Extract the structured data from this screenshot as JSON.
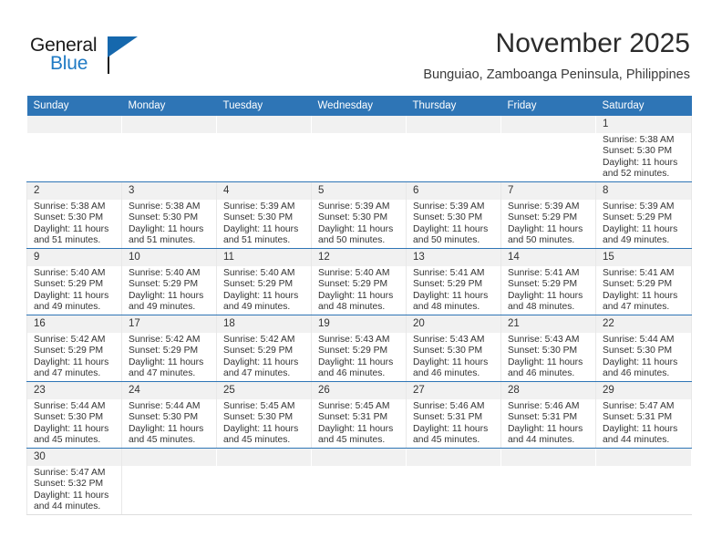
{
  "brand": {
    "name_part1": "General",
    "name_part2": "Blue",
    "flag_icon": "blue-flag-triangle",
    "colors": {
      "general_text": "#1a1a1a",
      "blue_text": "#1f7ac4",
      "flag": "#1668ad"
    }
  },
  "header": {
    "title": "November 2025",
    "subtitle": "Bunguiao, Zamboanga Peninsula, Philippines"
  },
  "theme": {
    "header_row_bg": "#2e75b6",
    "header_row_text": "#ffffff",
    "daynum_bg": "#f1f1f1",
    "row_divider": "#2e75b6",
    "cell_divider": "#e8e8e8",
    "body_text": "#333333"
  },
  "weekdays": [
    "Sunday",
    "Monday",
    "Tuesday",
    "Wednesday",
    "Thursday",
    "Friday",
    "Saturday"
  ],
  "weeks": [
    [
      {
        "day": "",
        "lines": []
      },
      {
        "day": "",
        "lines": []
      },
      {
        "day": "",
        "lines": []
      },
      {
        "day": "",
        "lines": []
      },
      {
        "day": "",
        "lines": []
      },
      {
        "day": "",
        "lines": []
      },
      {
        "day": "1",
        "lines": [
          "Sunrise: 5:38 AM",
          "Sunset: 5:30 PM",
          "Daylight: 11 hours",
          "and 52 minutes."
        ]
      }
    ],
    [
      {
        "day": "2",
        "lines": [
          "Sunrise: 5:38 AM",
          "Sunset: 5:30 PM",
          "Daylight: 11 hours",
          "and 51 minutes."
        ]
      },
      {
        "day": "3",
        "lines": [
          "Sunrise: 5:38 AM",
          "Sunset: 5:30 PM",
          "Daylight: 11 hours",
          "and 51 minutes."
        ]
      },
      {
        "day": "4",
        "lines": [
          "Sunrise: 5:39 AM",
          "Sunset: 5:30 PM",
          "Daylight: 11 hours",
          "and 51 minutes."
        ]
      },
      {
        "day": "5",
        "lines": [
          "Sunrise: 5:39 AM",
          "Sunset: 5:30 PM",
          "Daylight: 11 hours",
          "and 50 minutes."
        ]
      },
      {
        "day": "6",
        "lines": [
          "Sunrise: 5:39 AM",
          "Sunset: 5:30 PM",
          "Daylight: 11 hours",
          "and 50 minutes."
        ]
      },
      {
        "day": "7",
        "lines": [
          "Sunrise: 5:39 AM",
          "Sunset: 5:29 PM",
          "Daylight: 11 hours",
          "and 50 minutes."
        ]
      },
      {
        "day": "8",
        "lines": [
          "Sunrise: 5:39 AM",
          "Sunset: 5:29 PM",
          "Daylight: 11 hours",
          "and 49 minutes."
        ]
      }
    ],
    [
      {
        "day": "9",
        "lines": [
          "Sunrise: 5:40 AM",
          "Sunset: 5:29 PM",
          "Daylight: 11 hours",
          "and 49 minutes."
        ]
      },
      {
        "day": "10",
        "lines": [
          "Sunrise: 5:40 AM",
          "Sunset: 5:29 PM",
          "Daylight: 11 hours",
          "and 49 minutes."
        ]
      },
      {
        "day": "11",
        "lines": [
          "Sunrise: 5:40 AM",
          "Sunset: 5:29 PM",
          "Daylight: 11 hours",
          "and 49 minutes."
        ]
      },
      {
        "day": "12",
        "lines": [
          "Sunrise: 5:40 AM",
          "Sunset: 5:29 PM",
          "Daylight: 11 hours",
          "and 48 minutes."
        ]
      },
      {
        "day": "13",
        "lines": [
          "Sunrise: 5:41 AM",
          "Sunset: 5:29 PM",
          "Daylight: 11 hours",
          "and 48 minutes."
        ]
      },
      {
        "day": "14",
        "lines": [
          "Sunrise: 5:41 AM",
          "Sunset: 5:29 PM",
          "Daylight: 11 hours",
          "and 48 minutes."
        ]
      },
      {
        "day": "15",
        "lines": [
          "Sunrise: 5:41 AM",
          "Sunset: 5:29 PM",
          "Daylight: 11 hours",
          "and 47 minutes."
        ]
      }
    ],
    [
      {
        "day": "16",
        "lines": [
          "Sunrise: 5:42 AM",
          "Sunset: 5:29 PM",
          "Daylight: 11 hours",
          "and 47 minutes."
        ]
      },
      {
        "day": "17",
        "lines": [
          "Sunrise: 5:42 AM",
          "Sunset: 5:29 PM",
          "Daylight: 11 hours",
          "and 47 minutes."
        ]
      },
      {
        "day": "18",
        "lines": [
          "Sunrise: 5:42 AM",
          "Sunset: 5:29 PM",
          "Daylight: 11 hours",
          "and 47 minutes."
        ]
      },
      {
        "day": "19",
        "lines": [
          "Sunrise: 5:43 AM",
          "Sunset: 5:29 PM",
          "Daylight: 11 hours",
          "and 46 minutes."
        ]
      },
      {
        "day": "20",
        "lines": [
          "Sunrise: 5:43 AM",
          "Sunset: 5:30 PM",
          "Daylight: 11 hours",
          "and 46 minutes."
        ]
      },
      {
        "day": "21",
        "lines": [
          "Sunrise: 5:43 AM",
          "Sunset: 5:30 PM",
          "Daylight: 11 hours",
          "and 46 minutes."
        ]
      },
      {
        "day": "22",
        "lines": [
          "Sunrise: 5:44 AM",
          "Sunset: 5:30 PM",
          "Daylight: 11 hours",
          "and 46 minutes."
        ]
      }
    ],
    [
      {
        "day": "23",
        "lines": [
          "Sunrise: 5:44 AM",
          "Sunset: 5:30 PM",
          "Daylight: 11 hours",
          "and 45 minutes."
        ]
      },
      {
        "day": "24",
        "lines": [
          "Sunrise: 5:44 AM",
          "Sunset: 5:30 PM",
          "Daylight: 11 hours",
          "and 45 minutes."
        ]
      },
      {
        "day": "25",
        "lines": [
          "Sunrise: 5:45 AM",
          "Sunset: 5:30 PM",
          "Daylight: 11 hours",
          "and 45 minutes."
        ]
      },
      {
        "day": "26",
        "lines": [
          "Sunrise: 5:45 AM",
          "Sunset: 5:31 PM",
          "Daylight: 11 hours",
          "and 45 minutes."
        ]
      },
      {
        "day": "27",
        "lines": [
          "Sunrise: 5:46 AM",
          "Sunset: 5:31 PM",
          "Daylight: 11 hours",
          "and 45 minutes."
        ]
      },
      {
        "day": "28",
        "lines": [
          "Sunrise: 5:46 AM",
          "Sunset: 5:31 PM",
          "Daylight: 11 hours",
          "and 44 minutes."
        ]
      },
      {
        "day": "29",
        "lines": [
          "Sunrise: 5:47 AM",
          "Sunset: 5:31 PM",
          "Daylight: 11 hours",
          "and 44 minutes."
        ]
      }
    ],
    [
      {
        "day": "30",
        "lines": [
          "Sunrise: 5:47 AM",
          "Sunset: 5:32 PM",
          "Daylight: 11 hours",
          "and 44 minutes."
        ]
      },
      {
        "day": "",
        "lines": []
      },
      {
        "day": "",
        "lines": []
      },
      {
        "day": "",
        "lines": []
      },
      {
        "day": "",
        "lines": []
      },
      {
        "day": "",
        "lines": []
      },
      {
        "day": "",
        "lines": []
      }
    ]
  ]
}
